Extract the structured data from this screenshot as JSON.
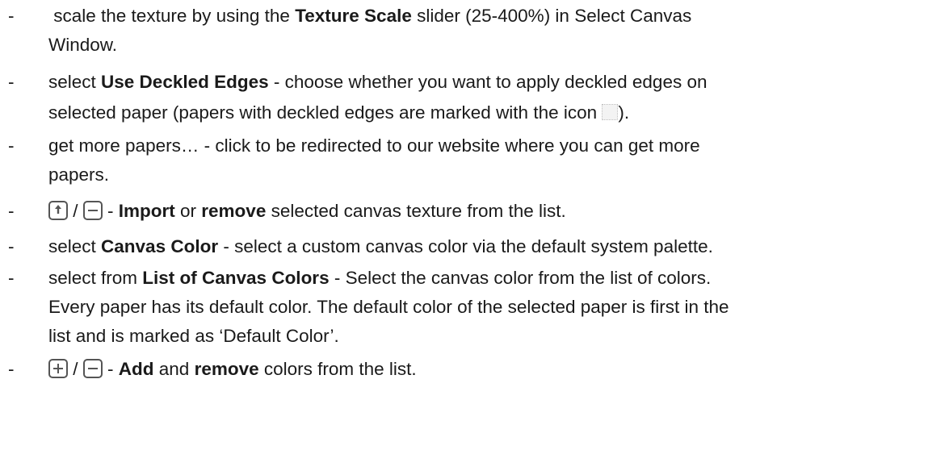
{
  "items": [
    {
      "lines": [
        [
          {
            "t": " scale the texture by using the "
          },
          {
            "b": "Texture Scale"
          },
          {
            "t": " slider (25-400%) in Select Canvas"
          }
        ],
        [
          {
            "t": "Window."
          }
        ]
      ]
    },
    {
      "lines": [
        [
          {
            "t": "select "
          },
          {
            "b": "Use Deckled Edges"
          },
          {
            "t": " - choose whether you want to apply deckled edges on"
          }
        ],
        [
          {
            "t": "selected paper (papers with deckled edges are marked with the icon "
          },
          {
            "i": "deckle"
          },
          {
            "t": ")."
          }
        ]
      ]
    },
    {
      "lines": [
        [
          {
            "t": "get more papers… - click to be redirected to our website where you can get more"
          }
        ],
        [
          {
            "t": "papers."
          }
        ]
      ]
    },
    {
      "lines": [
        [
          {
            "i": "import"
          },
          {
            "t": " / "
          },
          {
            "i": "remove"
          },
          {
            "t": " - "
          },
          {
            "b": "Import"
          },
          {
            "t": " or "
          },
          {
            "b": "remove"
          },
          {
            "t": " selected canvas texture from the list."
          }
        ]
      ]
    },
    {
      "lines": [
        [
          {
            "t": "select "
          },
          {
            "b": "Canvas Color"
          },
          {
            "t": " - select a custom canvas color via the default system palette."
          }
        ]
      ]
    },
    {
      "lines": [
        [
          {
            "t": "select from "
          },
          {
            "b": "List of Canvas Colors"
          },
          {
            "t": " - Select the canvas color from the list of colors."
          }
        ],
        [
          {
            "t": "Every paper has its default color. The default color of the selected paper is first in the"
          }
        ],
        [
          {
            "t": "list and is marked as ‘Default Color’."
          }
        ]
      ]
    },
    {
      "lines": [
        [
          {
            "i": "add"
          },
          {
            "t": " / "
          },
          {
            "i": "remove"
          },
          {
            "t": " - "
          },
          {
            "b": "Add"
          },
          {
            "t": " and "
          },
          {
            "b": "remove"
          },
          {
            "t": " colors from the list."
          }
        ]
      ]
    }
  ],
  "bullet": "-",
  "icon_color": "#555555"
}
